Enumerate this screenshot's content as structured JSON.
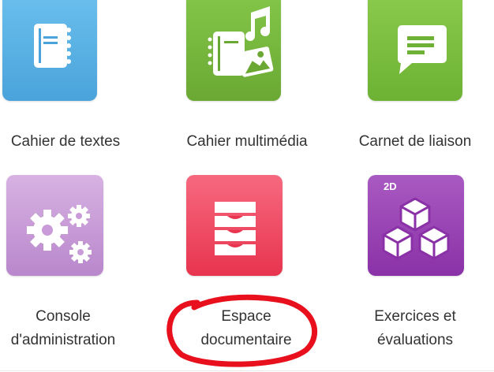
{
  "apps": [
    {
      "label": "Cahier de textes",
      "icon": "notebook-icon",
      "color": "#58b2e4"
    },
    {
      "label": "Cahier multimédia",
      "icon": "multimedia-notebook-icon",
      "color": "#76b83c"
    },
    {
      "label": "Carnet de liaison",
      "icon": "speech-bubble-icon",
      "color": "#7dbd3d"
    },
    {
      "label_line1": "Console",
      "label_line2": "d'administration",
      "icon": "gears-icon",
      "color": "#c79bd6"
    },
    {
      "label_line1": "Espace",
      "label_line2": "documentaire",
      "icon": "drawers-icon",
      "color": "#ee3b5c"
    },
    {
      "label_line1": "Exercices et",
      "label_line2": "évaluations",
      "icon": "cubes-icon",
      "color": "#9b3fb7",
      "badge": "2D"
    }
  ],
  "highlight_color": "#e8101c"
}
